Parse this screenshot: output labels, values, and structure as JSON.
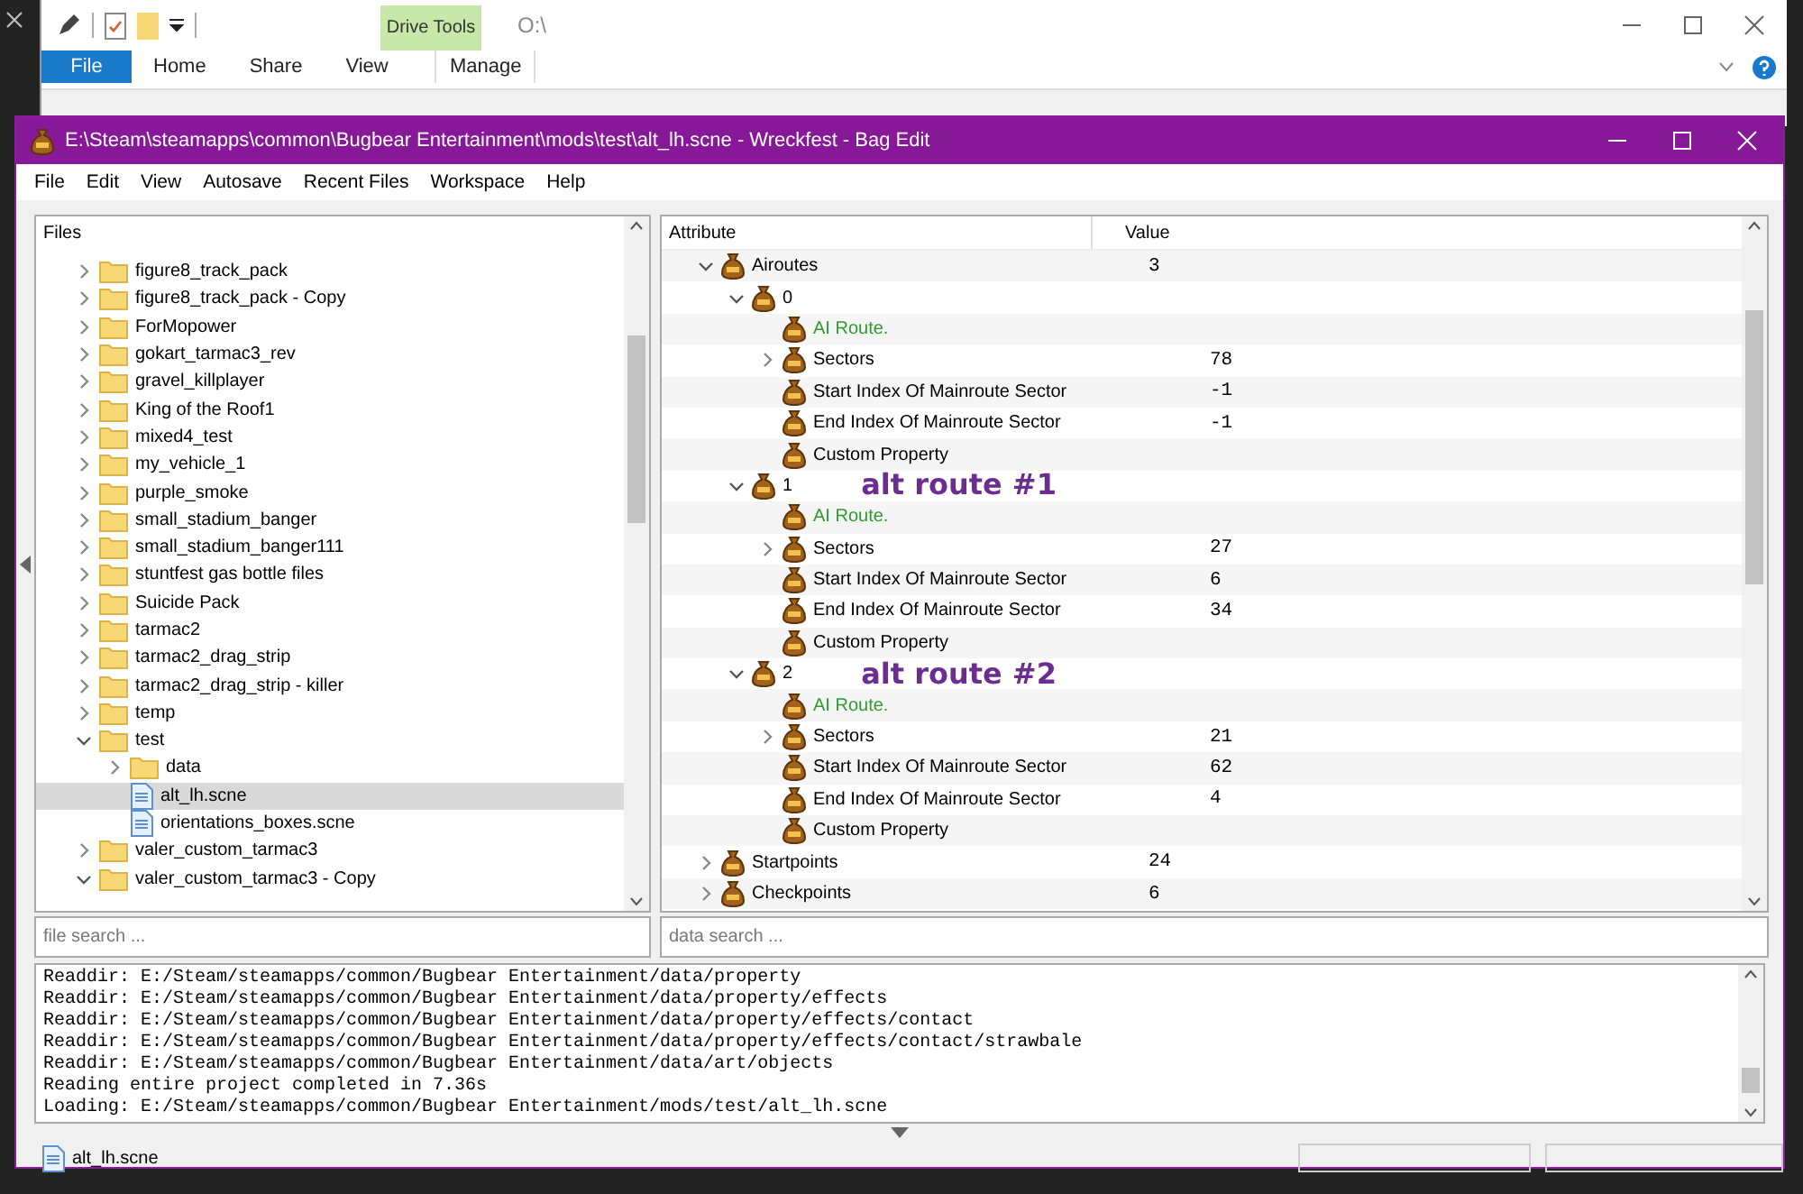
{
  "explorer": {
    "contextual_group": "Drive Tools",
    "path": "O:\\",
    "tabs": [
      {
        "label": "File",
        "kind": "file"
      },
      {
        "label": "Home",
        "kind": "normal"
      },
      {
        "label": "Share",
        "kind": "normal"
      },
      {
        "label": "View",
        "kind": "normal"
      },
      {
        "label": "Manage",
        "kind": "contextual"
      }
    ]
  },
  "window": {
    "title": "E:\\Steam\\steamapps\\common\\Bugbear Entertainment\\mods\\test\\alt_lh.scne - Wreckfest - Bag Edit"
  },
  "menu": [
    "File",
    "Edit",
    "View",
    "Autosave",
    "Recent Files",
    "Workspace",
    "Help"
  ],
  "file_tree": {
    "header": "Files",
    "items": [
      {
        "label": "figure8_track_pack",
        "kind": "folder",
        "expanded": false,
        "selected": false
      },
      {
        "label": "figure8_track_pack - Copy",
        "kind": "folder",
        "expanded": false,
        "selected": false
      },
      {
        "label": "ForMopower",
        "kind": "folder",
        "expanded": false,
        "selected": false
      },
      {
        "label": "gokart_tarmac3_rev",
        "kind": "folder",
        "expanded": false,
        "selected": false
      },
      {
        "label": "gravel_killplayer",
        "kind": "folder",
        "expanded": false,
        "selected": false
      },
      {
        "label": "King of the Roof1",
        "kind": "folder",
        "expanded": false,
        "selected": false
      },
      {
        "label": "mixed4_test",
        "kind": "folder",
        "expanded": false,
        "selected": false
      },
      {
        "label": "my_vehicle_1",
        "kind": "folder",
        "expanded": false,
        "selected": false
      },
      {
        "label": "purple_smoke",
        "kind": "folder",
        "expanded": false,
        "selected": false
      },
      {
        "label": "small_stadium_banger",
        "kind": "folder",
        "expanded": false,
        "selected": false
      },
      {
        "label": "small_stadium_banger111",
        "kind": "folder",
        "expanded": false,
        "selected": false
      },
      {
        "label": "stuntfest gas bottle files",
        "kind": "folder",
        "expanded": false,
        "selected": false
      },
      {
        "label": "Suicide Pack",
        "kind": "folder",
        "expanded": false,
        "selected": false
      },
      {
        "label": "tarmac2",
        "kind": "folder",
        "expanded": false,
        "selected": false
      },
      {
        "label": "tarmac2_drag_strip",
        "kind": "folder",
        "expanded": false,
        "selected": false
      },
      {
        "label": "tarmac2_drag_strip - killer",
        "kind": "folder",
        "expanded": false,
        "selected": false
      },
      {
        "label": "temp",
        "kind": "folder",
        "expanded": false,
        "selected": false
      },
      {
        "label": "test",
        "kind": "folder",
        "expanded": true,
        "selected": false,
        "children": [
          {
            "label": "data",
            "kind": "folder",
            "expanded": false,
            "selected": false
          },
          {
            "label": "alt_lh.scne",
            "kind": "file",
            "selected": true
          },
          {
            "label": "orientations_boxes.scne",
            "kind": "file",
            "selected": false
          }
        ]
      },
      {
        "label": "valer_custom_tarmac3",
        "kind": "folder",
        "expanded": false,
        "selected": false
      },
      {
        "label": "valer_custom_tarmac3 - Copy",
        "kind": "folder",
        "expanded": true,
        "selected": false
      }
    ]
  },
  "attributes": {
    "columns": [
      "Attribute",
      "Value"
    ],
    "rows": [
      {
        "name": "Airoutes",
        "value": "3",
        "expanded": true,
        "children": [
          {
            "name": "0",
            "expanded": true,
            "children": [
              {
                "name": "AI Route.",
                "kind": "comment"
              },
              {
                "name": "Sectors",
                "value": "78",
                "expanded": false
              },
              {
                "name": "Start Index Of Mainroute Sector",
                "value": "-1"
              },
              {
                "name": "End Index Of Mainroute Sector",
                "value": "-1"
              },
              {
                "name": "Custom Property"
              }
            ]
          },
          {
            "name": "1",
            "expanded": true,
            "annotation": "alt route #1",
            "children": [
              {
                "name": "AI Route.",
                "kind": "comment"
              },
              {
                "name": "Sectors",
                "value": "27",
                "expanded": false
              },
              {
                "name": "Start Index Of Mainroute Sector",
                "value": "6"
              },
              {
                "name": "End Index Of Mainroute Sector",
                "value": "34"
              },
              {
                "name": "Custom Property"
              }
            ]
          },
          {
            "name": "2",
            "expanded": true,
            "annotation": "alt route #2",
            "children": [
              {
                "name": "AI Route.",
                "kind": "comment"
              },
              {
                "name": "Sectors",
                "value": "21",
                "expanded": false
              },
              {
                "name": "Start Index Of Mainroute Sector",
                "value": "62"
              },
              {
                "name": "End Index Of Mainroute Sector",
                "value": "4"
              },
              {
                "name": "Custom Property"
              }
            ]
          }
        ]
      },
      {
        "name": "Startpoints",
        "value": "24",
        "expanded": false
      },
      {
        "name": "Checkpoints",
        "value": "6",
        "expanded": false
      }
    ]
  },
  "file_search": {
    "placeholder": "file search ..."
  },
  "data_search": {
    "placeholder": "data search ..."
  },
  "log": [
    "Readdir: E:/Steam/steamapps/common/Bugbear Entertainment/data/property",
    "Readdir: E:/Steam/steamapps/common/Bugbear Entertainment/data/property/effects",
    "Readdir: E:/Steam/steamapps/common/Bugbear Entertainment/data/property/effects/contact",
    "Readdir: E:/Steam/steamapps/common/Bugbear Entertainment/data/property/effects/contact/strawbale",
    "Readdir: E:/Steam/steamapps/common/Bugbear Entertainment/data/art/objects",
    "Reading entire project completed in 7.36s",
    "Loading: E:/Steam/steamapps/common/Bugbear Entertainment/mods/test/alt_lh.scne"
  ],
  "status_bar": {
    "file": "alt_lh.scne"
  }
}
